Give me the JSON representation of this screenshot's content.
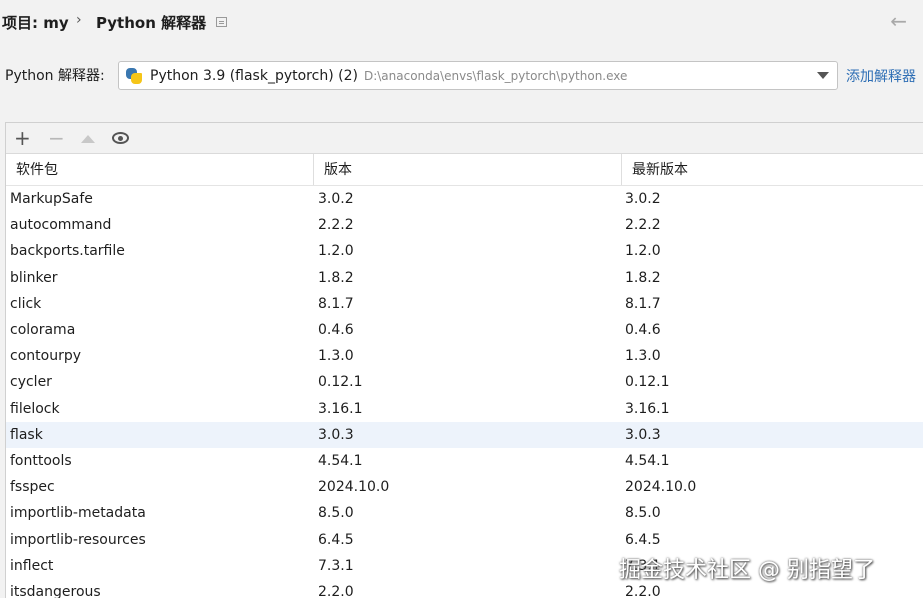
{
  "breadcrumb": {
    "project": "项目: my",
    "separator": "›",
    "page": "Python 解释器"
  },
  "interpreter": {
    "label": "Python 解释器:",
    "selected_name": "Python 3.9 (flask_pytorch) (2)",
    "selected_path": "D:\\anaconda\\envs\\flask_pytorch\\python.exe",
    "add_link": "添加解释器"
  },
  "toolbar": {
    "add": "+",
    "remove": "−"
  },
  "table": {
    "columns": [
      "软件包",
      "版本",
      "最新版本"
    ],
    "rows": [
      [
        "MarkupSafe",
        "3.0.2",
        "3.0.2"
      ],
      [
        "autocommand",
        "2.2.2",
        "2.2.2"
      ],
      [
        "backports.tarfile",
        "1.2.0",
        "1.2.0"
      ],
      [
        "blinker",
        "1.8.2",
        "1.8.2"
      ],
      [
        "click",
        "8.1.7",
        "8.1.7"
      ],
      [
        "colorama",
        "0.4.6",
        "0.4.6"
      ],
      [
        "contourpy",
        "1.3.0",
        "1.3.0"
      ],
      [
        "cycler",
        "0.12.1",
        "0.12.1"
      ],
      [
        "filelock",
        "3.16.1",
        "3.16.1"
      ],
      [
        "flask",
        "3.0.3",
        "3.0.3"
      ],
      [
        "fonttools",
        "4.54.1",
        "4.54.1"
      ],
      [
        "fsspec",
        "2024.10.0",
        "2024.10.0"
      ],
      [
        "importlib-metadata",
        "8.5.0",
        "8.5.0"
      ],
      [
        "importlib-resources",
        "6.4.5",
        "6.4.5"
      ],
      [
        "inflect",
        "7.3.1",
        "7.3.1"
      ],
      [
        "itsdangerous",
        "2.2.0",
        "2.2.0"
      ]
    ],
    "selected_row": 9
  },
  "watermark": "掘金技术社区 @ 别指望了",
  "colors": {
    "link": "#2f6fb5",
    "selection": "#edf3fb",
    "background": "#f2f2f2"
  }
}
